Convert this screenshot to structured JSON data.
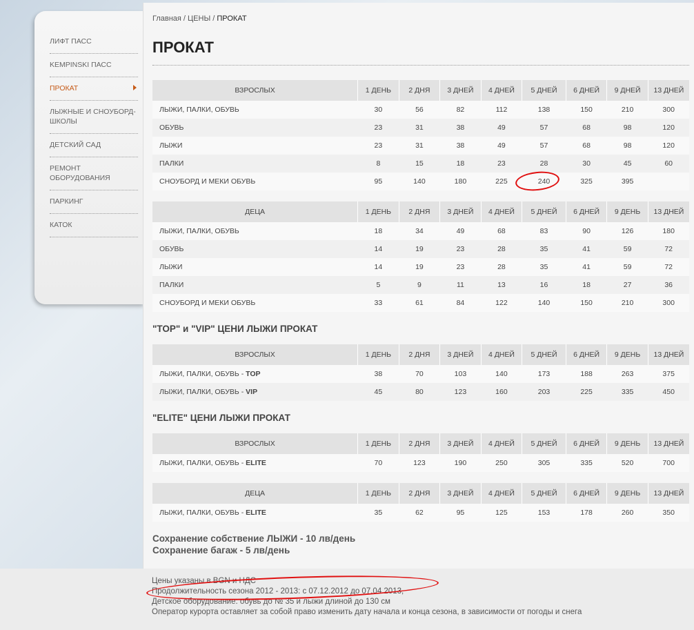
{
  "sidebar": {
    "items": [
      {
        "label": "ЛИФТ ПАСС"
      },
      {
        "label": "KEMPINSKI ПАСС"
      },
      {
        "label": "ПРОКАТ"
      },
      {
        "label": "ЛЫЖНЫЕ И СНОУБОРД-ШКОЛЫ"
      },
      {
        "label": "ДЕТСКИЙ САД"
      },
      {
        "label": "РЕМОНТ ОБОРУДОВАНИЯ"
      },
      {
        "label": "ПАРКИНГ"
      },
      {
        "label": "КАТОК"
      }
    ]
  },
  "breadcrumb": {
    "home": "Главная",
    "sep": " / ",
    "prices": "ЦЕНЫ",
    "current": "ПРОКАТ"
  },
  "page_title": "ПРОКАТ",
  "tables": [
    {
      "header": [
        "ВЗРОСЛЫХ",
        "1 ДЕНЬ",
        "2 ДНЯ",
        "3 ДНЕЙ",
        "4 ДНЕЙ",
        "5 ДНЕЙ",
        "6 ДНЕЙ",
        "9 ДНЕЙ",
        "13 ДНЕЙ"
      ],
      "rows": [
        {
          "label": "ЛЫЖИ, ПАЛКИ, ОБУВЬ",
          "values": [
            "30",
            "56",
            "82",
            "112",
            "138",
            "150",
            "210",
            "300"
          ]
        },
        {
          "label": "ОБУВЬ",
          "values": [
            "23",
            "31",
            "38",
            "49",
            "57",
            "68",
            "98",
            "120"
          ]
        },
        {
          "label": "ЛЫЖИ",
          "values": [
            "23",
            "31",
            "38",
            "49",
            "57",
            "68",
            "98",
            "120"
          ]
        },
        {
          "label": "ПАЛКИ",
          "values": [
            "8",
            "15",
            "18",
            "23",
            "28",
            "30",
            "45",
            "60"
          ]
        },
        {
          "label": "СНОУБОРД И МЕКИ ОБУВЬ",
          "values": [
            "95",
            "140",
            "180",
            "225",
            "240",
            "325",
            "395",
            ""
          ]
        }
      ]
    },
    {
      "header": [
        "ДЕЦА",
        "1 ДЕНЬ",
        "2 ДНЯ",
        "3 ДНЕЙ",
        "4 ДНЕЙ",
        "5 ДНЕЙ",
        "6 ДНЕЙ",
        "9 ДЕНЬ",
        "13 ДНЕЙ"
      ],
      "rows": [
        {
          "label": "ЛЫЖИ, ПАЛКИ, ОБУВЬ",
          "values": [
            "18",
            "34",
            "49",
            "68",
            "83",
            "90",
            "126",
            "180"
          ]
        },
        {
          "label": "ОБУВЬ",
          "values": [
            "14",
            "19",
            "23",
            "28",
            "35",
            "41",
            "59",
            "72"
          ]
        },
        {
          "label": "ЛЫЖИ",
          "values": [
            "14",
            "19",
            "23",
            "28",
            "35",
            "41",
            "59",
            "72"
          ]
        },
        {
          "label": "ПАЛКИ",
          "values": [
            "5",
            "9",
            "11",
            "13",
            "16",
            "18",
            "27",
            "36"
          ]
        },
        {
          "label": "СНОУБОРД И МЕКИ ОБУВЬ",
          "values": [
            "33",
            "61",
            "84",
            "122",
            "140",
            "150",
            "210",
            "300"
          ]
        }
      ]
    },
    {
      "title": "\"TOP\" и \"VIP\" ЦЕНИ ЛЫЖИ ПРОКАТ",
      "header": [
        "ВЗРОСЛЫХ",
        "1 ДЕНЬ",
        "2 ДНЯ",
        "3 ДНЕЙ",
        "4 ДНЕЙ",
        "5 ДНЕЙ",
        "6 ДНЕЙ",
        "9 ДЕНЬ",
        "13 ДНЕЙ"
      ],
      "rows": [
        {
          "label": "ЛЫЖИ, ПАЛКИ, ОБУВЬ - ",
          "strong": "TOP",
          "values": [
            "38",
            "70",
            "103",
            "140",
            "173",
            "188",
            "263",
            "375"
          ]
        },
        {
          "label": "ЛЫЖИ, ПАЛКИ, ОБУВЬ - ",
          "strong": "VIP",
          "values": [
            "45",
            "80",
            "123",
            "160",
            "203",
            "225",
            "335",
            "450"
          ]
        }
      ]
    },
    {
      "title": "\"ELITE\" ЦЕНИ ЛЫЖИ ПРОКАТ",
      "header": [
        "ВЗРОСЛЫХ",
        "1 ДЕНЬ",
        "2 ДНЯ",
        "3 ДНЕЙ",
        "4 ДНЕЙ",
        "5 ДНЕЙ",
        "6 ДНЕЙ",
        "9 ДЕНЬ",
        "13 ДНЕЙ"
      ],
      "rows": [
        {
          "label": "ЛЫЖИ, ПАЛКИ, ОБУВЬ - ",
          "strong": "ELITE",
          "values": [
            "70",
            "123",
            "190",
            "250",
            "305",
            "335",
            "520",
            "700"
          ]
        }
      ]
    },
    {
      "header": [
        "ДЕЦА",
        "1 ДЕНЬ",
        "2 ДНЯ",
        "3 ДНЕЙ",
        "4 ДНЕЙ",
        "5 ДНЕЙ",
        "6 ДНЕЙ",
        "9 ДЕНЬ",
        "13 ДНЕЙ"
      ],
      "rows": [
        {
          "label": "ЛЫЖИ, ПАЛКИ, ОБУВЬ - ",
          "strong": "ELITE",
          "values": [
            "35",
            "62",
            "95",
            "125",
            "153",
            "178",
            "260",
            "350"
          ]
        }
      ]
    }
  ],
  "storage": {
    "line1": "Сохранение собствение ЛЫЖИ - 10 лв/день",
    "line2": "Сохранение багаж - 5 лв/день"
  },
  "notes": [
    "Цены указаны в BGN и НДС",
    "Продолжительность сезона 2012 - 2013: с 07.12.2012 до 07.04.2013,",
    "Детское оборудование: обувь до № 35 и лыжи длиной до 130 см",
    "Оператор курорта оставляет за собой право изменить дату начала и конца сезона, в зависимости от погоды и снега"
  ],
  "colors": {
    "accent": "#c65a17",
    "annotation": "#e01010",
    "header_bg": "#e2e2e2"
  }
}
